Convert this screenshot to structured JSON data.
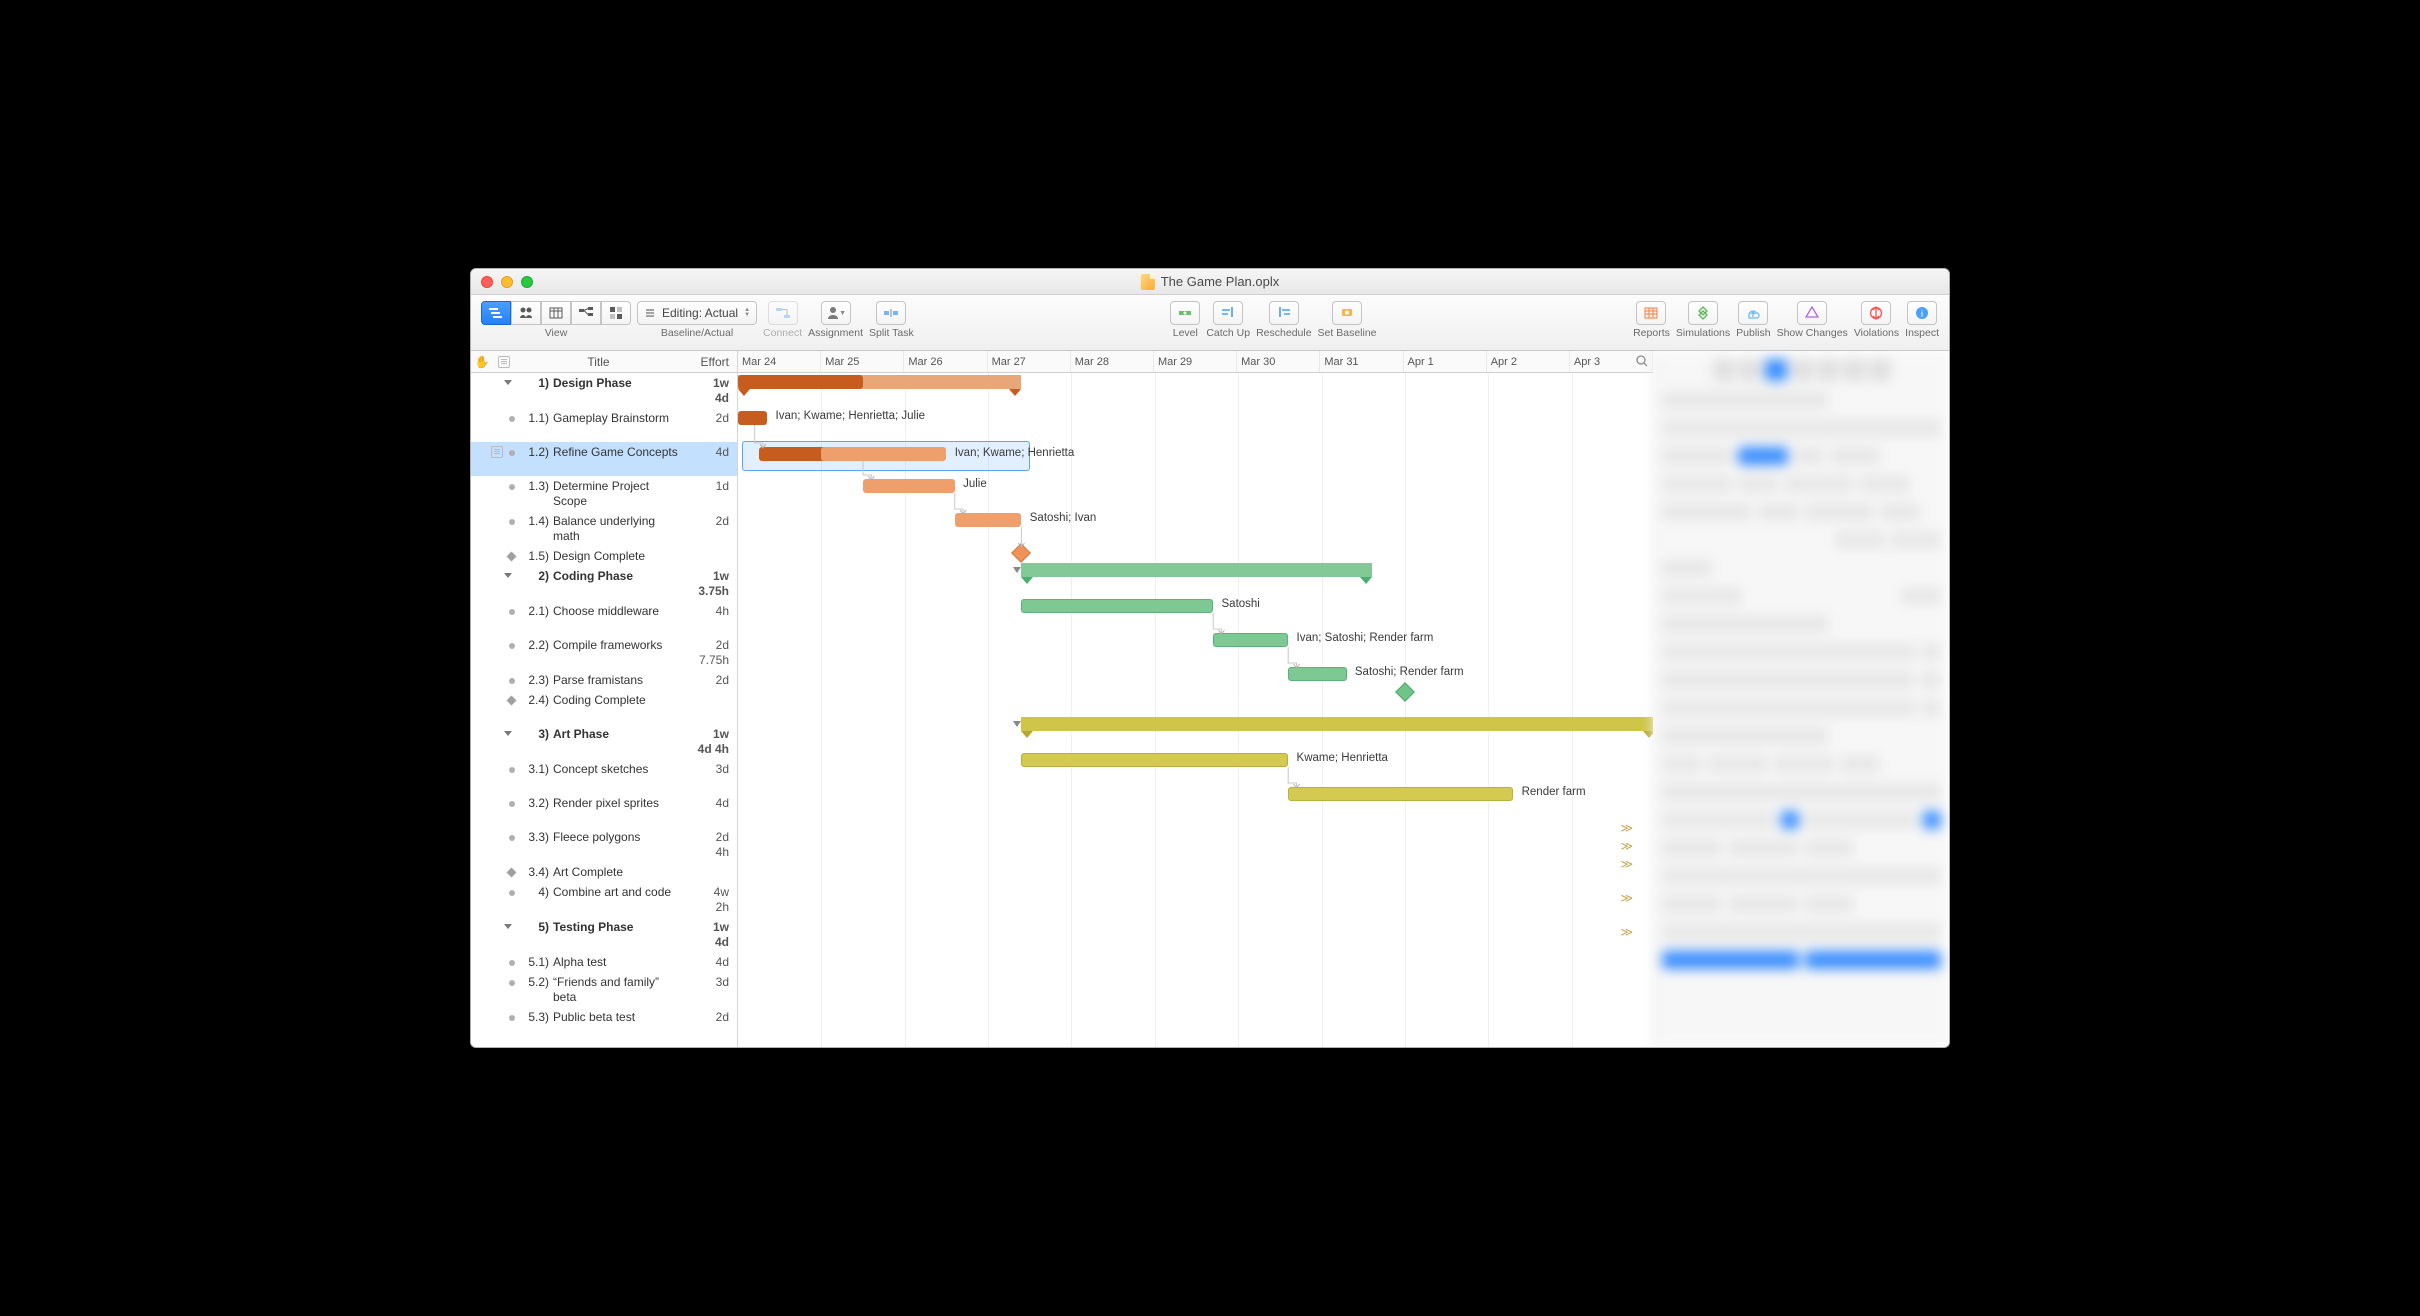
{
  "window": {
    "title": "The Game Plan.oplx"
  },
  "toolbar": {
    "view_label": "View",
    "baseline_label": "Baseline/Actual",
    "baseline_dropdown": "Editing: Actual",
    "connect": "Connect",
    "assignment": "Assignment",
    "split_task": "Split Task",
    "level": "Level",
    "catch_up": "Catch Up",
    "reschedule": "Reschedule",
    "set_baseline": "Set Baseline",
    "reports": "Reports",
    "simulations": "Simulations",
    "publish": "Publish",
    "show_changes": "Show Changes",
    "violations": "Violations",
    "inspect": "Inspect"
  },
  "outline": {
    "title_col": "Title",
    "effort_col": "Effort",
    "rows": [
      {
        "type": "group",
        "idx": "1)",
        "title": "Design Phase",
        "effort": "1w 4d"
      },
      {
        "type": "task",
        "idx": "1.1)",
        "title": "Gameplay Brainstorm",
        "effort": "2d"
      },
      {
        "type": "task",
        "idx": "1.2)",
        "title": "Refine Game Concepts",
        "effort": "4d",
        "selected": true
      },
      {
        "type": "task",
        "idx": "1.3)",
        "title": "Determine Project Scope",
        "effort": "1d"
      },
      {
        "type": "task",
        "idx": "1.4)",
        "title": "Balance underlying math",
        "effort": "2d"
      },
      {
        "type": "milestone",
        "idx": "1.5)",
        "title": "Design Complete",
        "effort": ""
      },
      {
        "type": "group",
        "idx": "2)",
        "title": "Coding Phase",
        "effort": "1w 3.75h"
      },
      {
        "type": "task",
        "idx": "2.1)",
        "title": "Choose middleware",
        "effort": "4h"
      },
      {
        "type": "task",
        "idx": "2.2)",
        "title": "Compile frameworks",
        "effort": "2d 7.75h"
      },
      {
        "type": "task",
        "idx": "2.3)",
        "title": "Parse framistans",
        "effort": "2d"
      },
      {
        "type": "milestone",
        "idx": "2.4)",
        "title": "Coding Complete",
        "effort": ""
      },
      {
        "type": "group",
        "idx": "3)",
        "title": "Art Phase",
        "effort": "1w 4d 4h"
      },
      {
        "type": "task",
        "idx": "3.1)",
        "title": "Concept sketches",
        "effort": "3d"
      },
      {
        "type": "task",
        "idx": "3.2)",
        "title": "Render pixel sprites",
        "effort": "4d"
      },
      {
        "type": "task",
        "idx": "3.3)",
        "title": "Fleece polygons",
        "effort": "2d 4h"
      },
      {
        "type": "milestone",
        "idx": "3.4)",
        "title": "Art Complete",
        "effort": ""
      },
      {
        "type": "task",
        "idx": "4)",
        "title": "Combine art and code",
        "effort": "4w 2h",
        "top": true
      },
      {
        "type": "group",
        "idx": "5)",
        "title": "Testing Phase",
        "effort": "1w 4d"
      },
      {
        "type": "task",
        "idx": "5.1)",
        "title": "Alpha test",
        "effort": "4d"
      },
      {
        "type": "task",
        "idx": "5.2)",
        "title": "“Friends and family” beta",
        "effort": "3d"
      },
      {
        "type": "task",
        "idx": "5.3)",
        "title": "Public beta test",
        "effort": "2d"
      }
    ]
  },
  "gantt": {
    "dates": [
      "Mar 24",
      "Mar 25",
      "Mar 26",
      "Mar 27",
      "Mar 28",
      "Mar 29",
      "Mar 30",
      "Mar 31",
      "Apr 1",
      "Apr 2",
      "Apr 3"
    ],
    "labels": {
      "r1": "Ivan; Kwame; Henrietta; Julie",
      "r2": "Ivan; Kwame; Henrietta",
      "r3": "Julie",
      "r4": "Satoshi; Ivan",
      "r7": "Satoshi",
      "r8": "Ivan; Satoshi; Render farm",
      "r9": "Satoshi; Render farm",
      "r12": "Kwame; Henrietta",
      "r13": "Render farm"
    }
  },
  "chart_data": {
    "type": "gantt",
    "x_dates": [
      "Mar 24",
      "Mar 25",
      "Mar 26",
      "Mar 27",
      "Mar 28",
      "Mar 29",
      "Mar 30",
      "Mar 31",
      "Apr 1",
      "Apr 2",
      "Apr 3"
    ],
    "series": [
      {
        "row": "1) Design Phase",
        "kind": "summary",
        "start": "Mar 24",
        "end": "Mar 27.4",
        "color": "orange",
        "inner": {
          "start": "Mar 24",
          "end": "Mar 25.5",
          "color": "orange-dark"
        }
      },
      {
        "row": "1.1) Gameplay Brainstorm",
        "kind": "task",
        "start": "Mar 24",
        "end": "Mar 24.35",
        "color": "orange-dark",
        "assigned": "Ivan; Kwame; Henrietta; Julie"
      },
      {
        "row": "1.2) Refine Game Concepts",
        "kind": "task",
        "start": "Mar 24.25",
        "end": "Mar 25.5",
        "color": "orange-dark",
        "overlay_end": "Mar 26.5",
        "assigned": "Ivan; Kwame; Henrietta",
        "selected": true
      },
      {
        "row": "1.3) Determine Project Scope",
        "kind": "task",
        "start": "Mar 25.5",
        "end": "Mar 26.6",
        "color": "orange-light",
        "assigned": "Julie"
      },
      {
        "row": "1.4) Balance underlying math",
        "kind": "task",
        "start": "Mar 26.6",
        "end": "Mar 27.4",
        "color": "orange-light",
        "assigned": "Satoshi; Ivan"
      },
      {
        "row": "1.5) Design Complete",
        "kind": "milestone",
        "at": "Mar 27.4",
        "color": "orange"
      },
      {
        "row": "2) Coding Phase",
        "kind": "summary",
        "start": "Mar 27.4",
        "end": "Apr 1.0",
        "color": "green"
      },
      {
        "row": "2.1) Choose middleware",
        "kind": "task",
        "start": "Mar 27.4",
        "end": "Mar 29.7",
        "color": "green",
        "assigned": "Satoshi"
      },
      {
        "row": "2.2) Compile frameworks",
        "kind": "task",
        "start": "Mar 29.7",
        "end": "Mar 30.6",
        "color": "green",
        "assigned": "Ivan; Satoshi; Render farm"
      },
      {
        "row": "2.3) Parse framistans",
        "kind": "task",
        "start": "Mar 30.6",
        "end": "Mar 31.3",
        "color": "green",
        "assigned": "Satoshi; Render farm"
      },
      {
        "row": "2.4) Coding Complete",
        "kind": "milestone",
        "at": "Apr 1.0",
        "color": "green"
      },
      {
        "row": "3) Art Phase",
        "kind": "summary",
        "start": "Mar 27.4",
        "end": "> Apr 3",
        "color": "yellow"
      },
      {
        "row": "3.1) Concept sketches",
        "kind": "task",
        "start": "Mar 27.4",
        "end": "Mar 30.6",
        "color": "yellow",
        "assigned": "Kwame; Henrietta"
      },
      {
        "row": "3.2) Render pixel sprites",
        "kind": "task",
        "start": "Mar 30.6",
        "end": "Apr 2.3",
        "color": "yellow",
        "assigned": "Render farm"
      },
      {
        "row": "3.3) Fleece polygons",
        "kind": "task",
        "overflow": true
      },
      {
        "row": "3.4) Art Complete",
        "kind": "milestone",
        "overflow": true
      },
      {
        "row": "4) Combine art and code",
        "kind": "task",
        "overflow": true
      },
      {
        "row": "5) Testing Phase",
        "kind": "summary",
        "overflow": true
      },
      {
        "row": "5.1) Alpha test",
        "kind": "task",
        "overflow": true
      }
    ]
  }
}
